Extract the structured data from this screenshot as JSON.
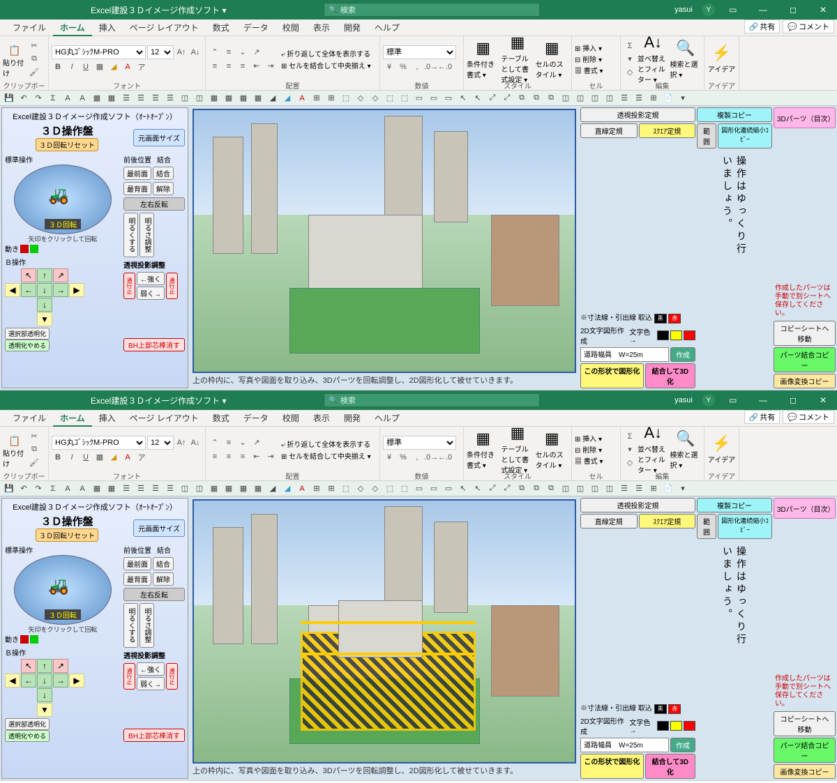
{
  "app": {
    "title": "Excel建設３Ｄイメージ作成ソフト ▾",
    "search_placeholder": "検索",
    "user": "yasui",
    "user_initial": "Y"
  },
  "tabs": {
    "file": "ファイル",
    "home": "ホーム",
    "insert": "挿入",
    "page": "ページ レイアウト",
    "formula": "数式",
    "data": "データ",
    "review": "校閲",
    "view": "表示",
    "dev": "開発",
    "help": "ヘルプ",
    "share": "共有",
    "comment": "コメント"
  },
  "ribbon": {
    "paste": "貼り付け",
    "clipboard": "クリップボード",
    "font_name": "HG丸ｺﾞｼｯｸM-PRO",
    "font_size": "12",
    "font": "フォント",
    "wrap": "折り返して全体を表示する",
    "merge": "セルを結合して中央揃え ▾",
    "align": "配置",
    "number_fmt": "標準",
    "number": "数値",
    "cond": "条件付き書式 ▾",
    "table": "テーブルとして書式設定 ▾",
    "cell": "セルのスタイル ▾",
    "style": "スタイル",
    "ins": "挿入 ▾",
    "del": "削除 ▾",
    "fmt": "書式 ▾",
    "cells": "セル",
    "sort": "並べ替えとフィルター ▾",
    "find": "検索と選択 ▾",
    "edit": "編集",
    "idea": "アイデア",
    "idea_grp": "アイデア"
  },
  "panel3d": {
    "heading": "Excel建設３Ｄイメージ作成ソフト（ｵｰﾄｵｰﾌﾟﾝ）",
    "title": "３Ｄ操作盤",
    "reset": "３Ｄ回転リセット",
    "imgsize": "元画面サイズ",
    "std_ops": "標準操作",
    "rot_label": "３Ｄ回転",
    "zengo": "前後位置",
    "combine": "結合",
    "front": "最前面",
    "back": "最背面",
    "merge": "結合",
    "release": "解除",
    "lrflip": "左右反転",
    "brighten": "明るくする",
    "bright_adj": "明るさ調整",
    "persp_adj": "透視投影調整",
    "stronger": "←強く",
    "weaker": "弱く→",
    "click_note": "矢印をクリックして回転",
    "move": "動き",
    "b_ops": "Ｂ操作",
    "sel_trans": "選択部透明化",
    "stop_trans": "透明化やめる",
    "bh_erase": "BH上部芯棒消す",
    "no_pass": "通行止"
  },
  "right": {
    "persp_ruler": "透視投影定規",
    "line_ruler": "直線定規",
    "square_ruler": "ｽｸｴｱ定規",
    "range": "範囲",
    "dup_copy": "複製コピー",
    "graph_shrink": "図形化連続縮小ｺﾋﾟｰ",
    "parts_index": "3Dパーツ（目次）",
    "slow_msg": "操作はゆっくり行いましょう。",
    "save_note": "作成したパーツは手動で別シートへ保存してください。",
    "copysheet": "コピーシートへ移動",
    "parts_copy": "パーツ結合コピー",
    "img_conv": "画像変換コピー",
    "dim_leader": "※寸法線・引出線 取込",
    "black": "黒",
    "red": "赤",
    "yellow": "黄",
    "twod": "2D文字図形作成",
    "text_color": "文字色→",
    "road_w": "道路幅員　W=25m",
    "make": "作成",
    "graph_btn": "この形状で図形化",
    "combine3d": "結合して3D化"
  },
  "caption": "上の枠内に、写真や図面を取り込み、3Dパーツを回転調整し、2D図形化して被せていきます。"
}
